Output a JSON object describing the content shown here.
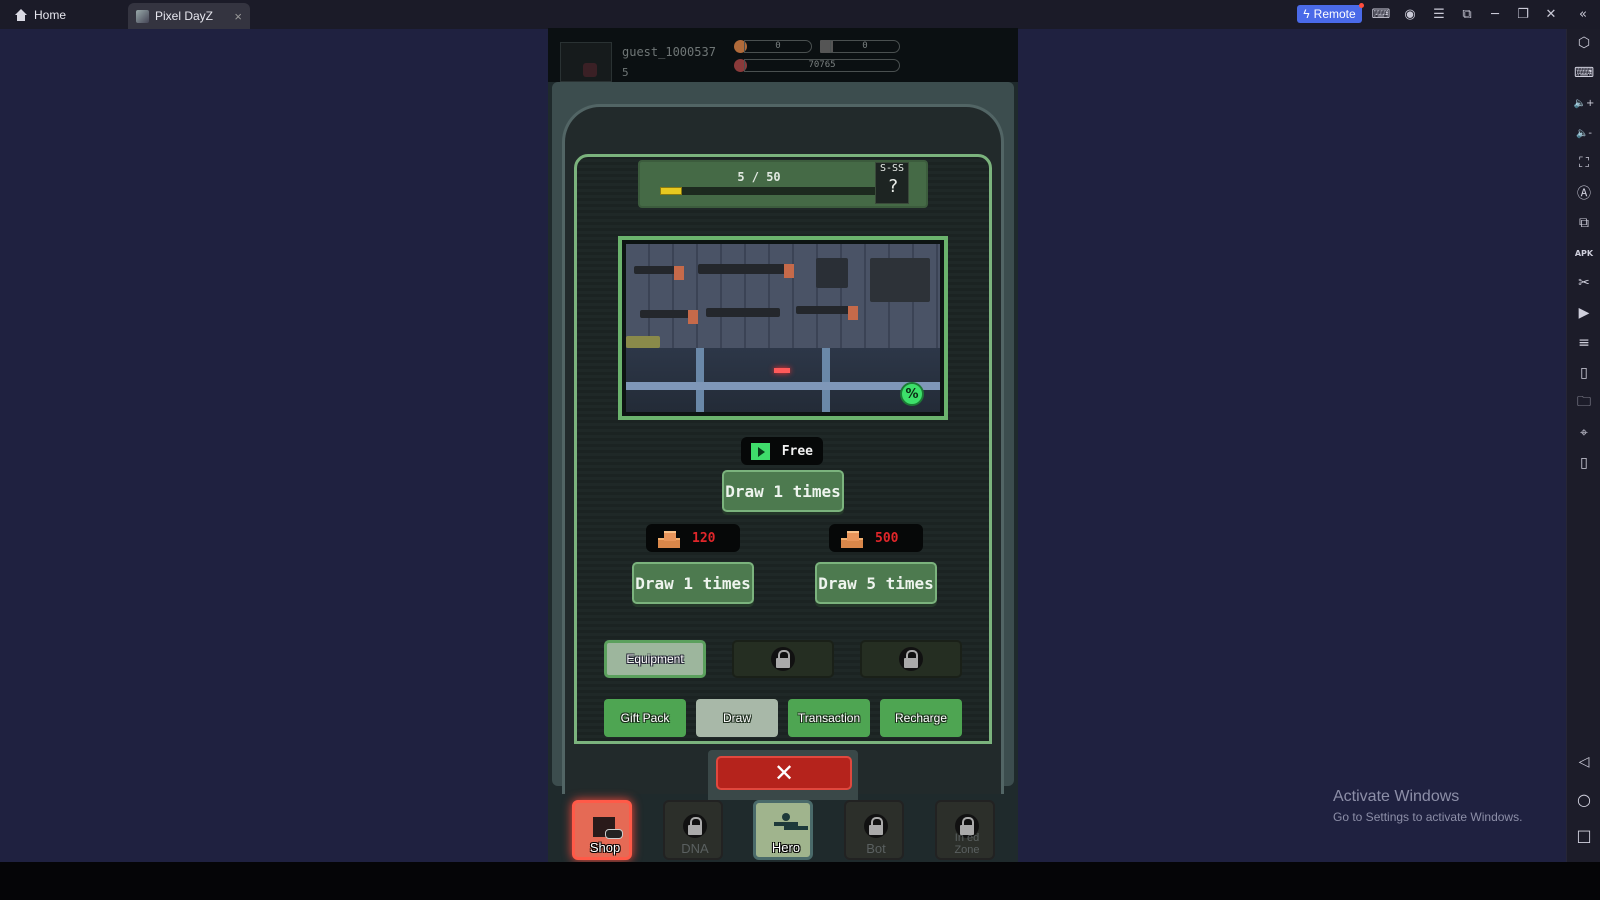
{
  "titlebar": {
    "tabs": [
      {
        "label": "Home",
        "icon": "home-icon",
        "active": false
      },
      {
        "label": "Pixel DayZ",
        "icon": "game-icon",
        "active": true,
        "close": "×"
      }
    ],
    "remote_label": "Remote",
    "controls": [
      {
        "name": "gamepad-icon",
        "glyph": "⌨"
      },
      {
        "name": "account-icon",
        "glyph": "◉"
      },
      {
        "name": "menu-icon",
        "glyph": "☰"
      },
      {
        "name": "screenshot-window-icon",
        "glyph": "⧉"
      },
      {
        "name": "minimize-icon",
        "glyph": "─"
      },
      {
        "name": "restore-icon",
        "glyph": "❐"
      },
      {
        "name": "close-window-icon",
        "glyph": "✕"
      },
      {
        "name": "collapse-sidebar-icon",
        "glyph": "«"
      }
    ]
  },
  "sidebar": {
    "top_items": [
      {
        "name": "settings-hex-icon",
        "glyph": "⬡"
      },
      {
        "name": "keyboard-icon",
        "glyph": "⌨"
      },
      {
        "name": "volume-up-icon",
        "glyph": "🔈+"
      },
      {
        "name": "volume-down-icon",
        "glyph": "🔈-"
      },
      {
        "name": "fullscreen-icon",
        "glyph": "⛶"
      },
      {
        "name": "auto-rotate-icon",
        "glyph": "Ⓐ"
      },
      {
        "name": "multi-instance-icon",
        "glyph": "⧉"
      },
      {
        "name": "apk-install-icon",
        "glyph": "APK"
      },
      {
        "name": "scissors-icon",
        "glyph": "✂"
      },
      {
        "name": "media-icon",
        "glyph": "▶"
      },
      {
        "name": "notes-icon",
        "glyph": "≡"
      },
      {
        "name": "shake-icon",
        "glyph": "▯"
      },
      {
        "name": "folder-icon",
        "glyph": "🗀"
      },
      {
        "name": "location-icon",
        "glyph": "⌖"
      },
      {
        "name": "rotate-device-icon",
        "glyph": "▯"
      }
    ],
    "bottom_items": [
      {
        "name": "back-icon",
        "glyph": "◁"
      },
      {
        "name": "home-circle-icon",
        "glyph": "○"
      },
      {
        "name": "recents-icon",
        "glyph": "□"
      }
    ]
  },
  "game": {
    "profile": {
      "username": "guest_1000537",
      "level": "5",
      "resources": [
        {
          "name": "gold",
          "value": "0"
        },
        {
          "name": "card",
          "value": "0"
        },
        {
          "name": "coin",
          "value": "70765"
        }
      ]
    },
    "draw_progress": {
      "current": 5,
      "max": 50,
      "text": "5 / 50",
      "fraction": 0.1,
      "rank_label": "S-SS",
      "rank_value": "?"
    },
    "banner": {
      "badge": "%"
    },
    "free_draw": {
      "cost_label": "Free",
      "button_label": "Draw 1 times"
    },
    "paid_draws": [
      {
        "cost": "120",
        "button_label": "Draw 1 times"
      },
      {
        "cost": "500",
        "button_label": "Draw 5 times"
      }
    ],
    "categories": [
      {
        "label": "Equipment",
        "locked": false,
        "active": true
      },
      {
        "label": "",
        "locked": true,
        "active": false
      },
      {
        "label": "",
        "locked": true,
        "active": false
      }
    ],
    "shop_tabs": [
      {
        "label": "Gift Pack",
        "active": false
      },
      {
        "label": "Draw",
        "active": true
      },
      {
        "label": "Transaction",
        "active": false
      },
      {
        "label": "Recharge",
        "active": false
      }
    ],
    "close_glyph": "✕",
    "bottom_nav": [
      {
        "label": "Shop",
        "state": "active"
      },
      {
        "label": "DNA",
        "state": "locked"
      },
      {
        "label": "Hero",
        "state": "normal"
      },
      {
        "label": "Bot",
        "state": "locked"
      },
      {
        "label": "Infected Zone",
        "label_visible": "In  ed\nZone",
        "state": "locked"
      }
    ]
  },
  "watermark": {
    "title": "Activate Windows",
    "subtitle": "Go to Settings to activate Windows."
  },
  "colors": {
    "remote_accent": "#4a6ae8",
    "primary_green": "#4d7a4f",
    "cost_red": "#e0262a",
    "close_red": "#b5231c",
    "progress_yellow": "#e8c920"
  }
}
